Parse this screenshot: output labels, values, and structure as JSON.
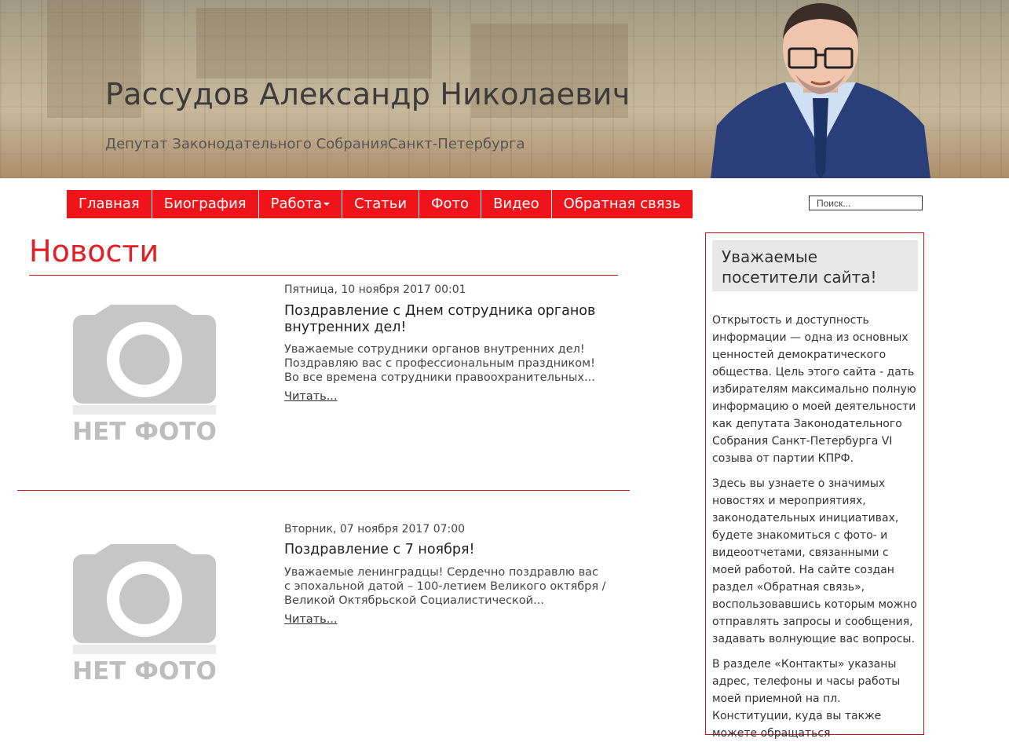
{
  "header": {
    "title": "Рассудов Александр Николаевич",
    "subtitle": "Депутат Законодательного СобранияСанкт-Петербурга"
  },
  "nav": {
    "items": [
      {
        "label": "Главная"
      },
      {
        "label": "Биография"
      },
      {
        "label": "Работа"
      },
      {
        "label": "Статьи"
      },
      {
        "label": "Фото"
      },
      {
        "label": "Видео"
      },
      {
        "label": "Обратная связь"
      }
    ]
  },
  "search": {
    "placeholder": "Поиск..."
  },
  "main": {
    "page_title": "Новости",
    "articles": [
      {
        "date": "Пятница, 10 ноября 2017 00:01",
        "title": "Поздравление с Днем сотрудника органов внутренних дел!",
        "excerpt": "Уважаемые сотрудники органов внутренних дел! Поздравляю вас с профессиональным праздником! Во все времена сотрудники правоохранительных...",
        "more": "Читать...",
        "image_label": "НЕТ ФОТО"
      },
      {
        "date": "Вторник, 07 ноября 2017 07:00",
        "title": "Поздравление с 7 ноября!",
        "excerpt": "Уважаемые ленинградцы! Сердечно поздравлю вас с эпохальной датой – 100-летием Великого октября / Великой Октябрьской Социалистической...",
        "more": "Читать...",
        "image_label": "НЕТ ФОТО"
      }
    ]
  },
  "sidebar": {
    "heading": "Уважаемые посетители сайта!",
    "paragraphs": [
      "Открытость и доступность информации — одна из основных ценностей демократического общества. Цель этого сайта - дать избирателям максимально полную информацию о моей деятельности как депутата Законодательного Собрания Санкт-Петербурга VI созыва от партии КПРФ.",
      "Здесь вы узнаете о значимых новостях и мероприятиях, законодательных инициативах, будете знакомиться с фото- и видеоотчетами, связанными с моей работой. На сайте создан раздел «Обратная связь», воспользовавшись которым можно отправлять запросы и сообщения, задавать волнующие вас вопросы.",
      "В разделе «Контакты» указаны адрес, телефоны и часы работы моей приемной на пл. Конституции, куда вы также можете обращаться"
    ]
  },
  "colors": {
    "accent": "#ef141a",
    "title_red": "#e31e24"
  }
}
